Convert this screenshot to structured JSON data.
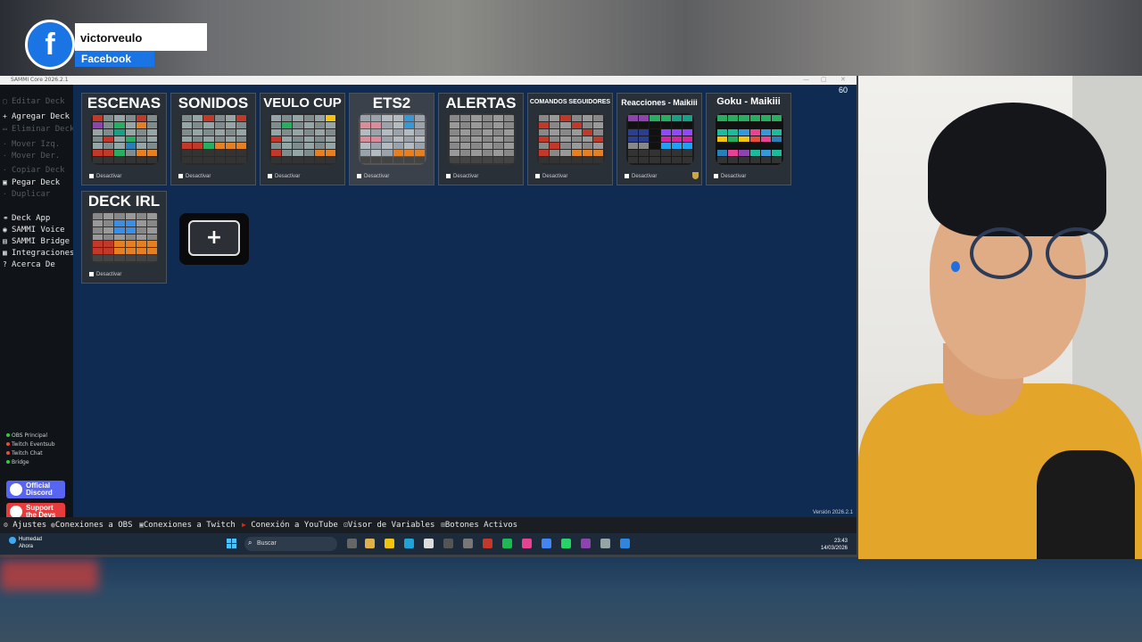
{
  "overlay": {
    "platform_letter": "f",
    "username": "victorveulo",
    "platform": "Facebook"
  },
  "window": {
    "title": "SAMMI Core 2026.2.1",
    "counter": "60",
    "version": "Versión 2026.2.1"
  },
  "sidebar": {
    "edit_items": [
      {
        "label": "Editar Deck",
        "enabled": false
      },
      {
        "label": "Agregar Deck",
        "enabled": true
      },
      {
        "label": "Eliminar Deck",
        "enabled": false
      },
      {
        "label": "Mover Izq.",
        "enabled": false
      },
      {
        "label": "Mover Der.",
        "enabled": false
      },
      {
        "label": "Copiar Deck",
        "enabled": false
      },
      {
        "label": "Pegar Deck",
        "enabled": true
      },
      {
        "label": "Duplicar",
        "enabled": false
      }
    ],
    "app_items": [
      {
        "label": "Deck App",
        "icon": "link-icon"
      },
      {
        "label": "SAMMI Voice",
        "icon": "voice-icon"
      },
      {
        "label": "SAMMI Bridge",
        "icon": "bridge-icon"
      },
      {
        "label": "Integraciones",
        "icon": "integrations-icon"
      },
      {
        "label": "Acerca De",
        "icon": "help-icon"
      }
    ],
    "status": [
      {
        "label": "OBS Principal",
        "color": "#2ecc40"
      },
      {
        "label": "Twitch Eventsub",
        "color": "#e74c3c"
      },
      {
        "label": "Twitch Chat",
        "color": "#e74c3c"
      },
      {
        "label": "Bridge",
        "color": "#2ecc40"
      }
    ],
    "discord": "Official Discord",
    "support": "Support the Devs"
  },
  "decks": [
    {
      "title": "ESCENAS",
      "size": "lg",
      "check": "Desactivar"
    },
    {
      "title": "SONIDOS",
      "size": "lg",
      "check": "Desactivar"
    },
    {
      "title": "VEULO CUP",
      "size": "lg",
      "check": "Desactivar"
    },
    {
      "title": "ETS2",
      "size": "lg",
      "check": "Desactivar"
    },
    {
      "title": "ALERTAS",
      "size": "lg",
      "check": "Desactivar"
    },
    {
      "title": "COMANDOS SEGUIDORES",
      "size": "xs",
      "check": "Desactivar"
    },
    {
      "title": "Reacciones - Maikiii",
      "size": "sm",
      "check": "Desactivar"
    },
    {
      "title": "Goku - Maikiii",
      "size": "sm",
      "check": "Desactivar"
    },
    {
      "title": "DECK IRL",
      "size": "lg",
      "check": "Desactivar"
    }
  ],
  "add_deck": "+",
  "bottombar": [
    {
      "label": "Ajustes",
      "icon": "gear-icon"
    },
    {
      "label": "Conexiones a OBS",
      "icon": "obs-icon"
    },
    {
      "label": "Conexiones a Twitch",
      "icon": "twitch-icon"
    },
    {
      "label": "Conexión a YouTube",
      "icon": "youtube-icon"
    },
    {
      "label": "Visor de Variables",
      "icon": "variables-icon"
    },
    {
      "label": "Botones Activos",
      "icon": "grid-icon"
    }
  ],
  "taskbar": {
    "weather_label": "Humedad",
    "weather_sub": "Ahora",
    "search": "Buscar",
    "time": "23:43",
    "date": "14/03/2026"
  }
}
